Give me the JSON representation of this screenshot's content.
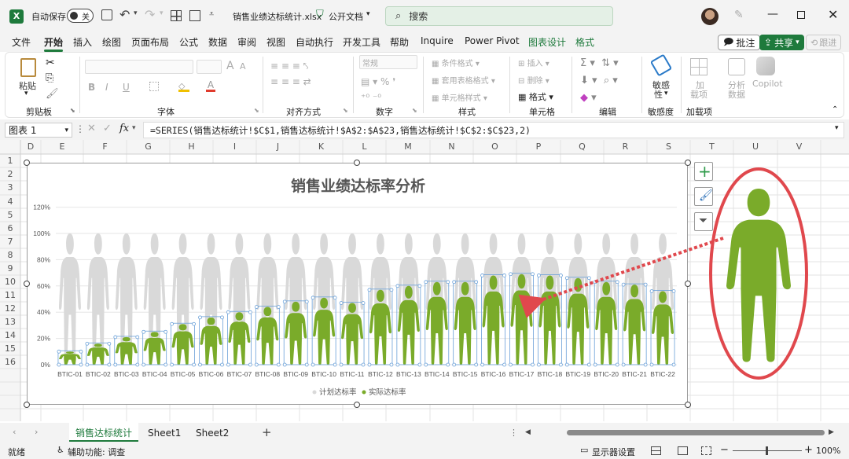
{
  "titlebar": {
    "autosave_label": "自动保存",
    "autosave_state": "关",
    "filename": "销售业绩达标统计.xlsx",
    "doc_state": "公开文档",
    "search_placeholder": "搜索"
  },
  "menu": {
    "tabs": [
      "文件",
      "开始",
      "插入",
      "绘图",
      "页面布局",
      "公式",
      "数据",
      "审阅",
      "视图",
      "自动执行",
      "开发工具",
      "帮助",
      "Inquire",
      "Power Pivot",
      "图表设计",
      "格式"
    ],
    "comment": "批注",
    "share": "共享",
    "catchup": "跟进"
  },
  "ribbon": {
    "clipboard": {
      "paste": "粘贴",
      "group": "剪贴板"
    },
    "font": {
      "bold": "B",
      "italic": "I",
      "underline": "U",
      "group": "字体",
      "grow": "A",
      "shrink": "A"
    },
    "align": {
      "group": "对齐方式"
    },
    "number": {
      "format": "常规",
      "group": "数字"
    },
    "styles": {
      "cond": "条件格式",
      "table": "套用表格格式",
      "cell": "单元格样式",
      "group": "样式"
    },
    "cells": {
      "insert": "插入",
      "delete": "删除",
      "format": "格式",
      "group": "单元格"
    },
    "edit": {
      "group": "编辑"
    },
    "sens": {
      "label1": "敏感",
      "label2": "性",
      "group": "敏感度"
    },
    "addins": {
      "label1": "加",
      "label2": "载项",
      "group": "加载项"
    },
    "analysis": {
      "label1": "分析",
      "label2": "数据"
    },
    "copilot": {
      "label": "Copilot"
    }
  },
  "formulabar": {
    "namebox": "图表 1",
    "fx": "fx",
    "formula": "=SERIES(销售达标统计!$C$1,销售达标统计!$A$2:$A$23,销售达标统计!$C$2:$C$23,2)"
  },
  "columns": [
    "D",
    "E",
    "F",
    "G",
    "H",
    "I",
    "J",
    "K",
    "L",
    "M",
    "N",
    "O",
    "P",
    "Q",
    "R",
    "S",
    "T",
    "U",
    "V"
  ],
  "rows": [
    "1",
    "2",
    "3",
    "4",
    "5",
    "6",
    "7",
    "8",
    "9",
    "10",
    "11",
    "12",
    "13",
    "14",
    "15",
    "16"
  ],
  "chart_data": {
    "type": "bar",
    "title": "销售业绩达标率分析",
    "categories": [
      "BTIC-01",
      "BTIC-02",
      "BTIC-03",
      "BTIC-04",
      "BTIC-05",
      "BTIC-06",
      "BTIC-07",
      "BTIC-08",
      "BTIC-09",
      "BTIC-10",
      "BTIC-11",
      "BTIC-12",
      "BTIC-13",
      "BTIC-14",
      "BTIC-15",
      "BTIC-16",
      "BTIC-17",
      "BTIC-18",
      "BTIC-19",
      "BTIC-20",
      "BTIC-21",
      "BTIC-22"
    ],
    "series": [
      {
        "name": "计划达标率",
        "values": [
          1,
          1,
          1,
          1,
          1,
          1,
          1,
          1,
          1,
          1,
          1,
          1,
          1,
          1,
          1,
          1,
          1,
          1,
          1,
          1,
          1,
          1
        ],
        "color": "#d9d9d9"
      },
      {
        "name": "实际达标率",
        "values": [
          0.1,
          0.16,
          0.21,
          0.25,
          0.31,
          0.36,
          0.4,
          0.44,
          0.48,
          0.51,
          0.47,
          0.57,
          0.6,
          0.63,
          0.63,
          0.68,
          0.69,
          0.68,
          0.66,
          0.63,
          0.61,
          0.56
        ],
        "color": "#7aab2a"
      }
    ],
    "yticks": [
      "0%",
      "20%",
      "40%",
      "60%",
      "80%",
      "100%",
      "120%"
    ],
    "ylim": [
      0,
      1.2
    ],
    "legend_position": "bottom"
  },
  "sheets": {
    "tabs": [
      "销售达标统计",
      "Sheet1",
      "Sheet2"
    ],
    "add": "+"
  },
  "status": {
    "ready": "就绪",
    "accessibility": "辅助功能: 调查",
    "display": "显示器设置",
    "zoom": "100%"
  }
}
